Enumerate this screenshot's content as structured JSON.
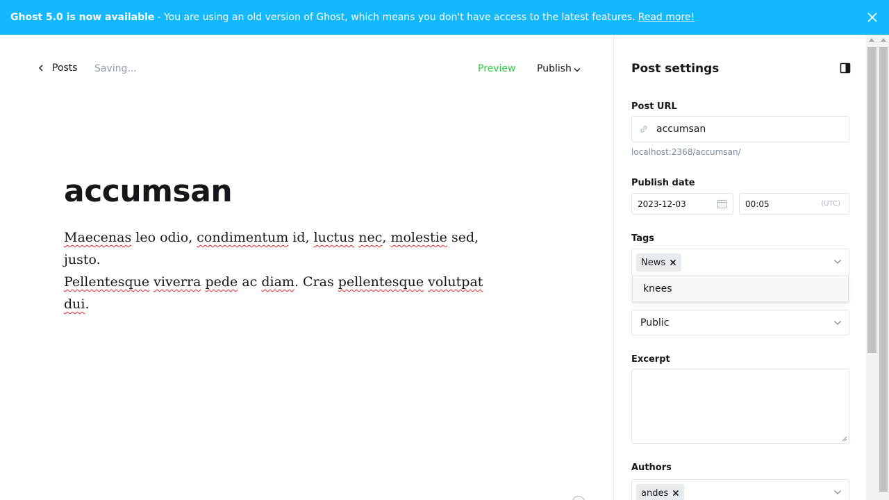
{
  "banner": {
    "strong": "Ghost 5.0 is now available",
    "message": "- You are using an old version of Ghost, which means you don't have access to the latest features.",
    "link": "Read more!",
    "bg_color": "#14b8ff"
  },
  "header": {
    "back_label": "Posts",
    "status": "Saving...",
    "preview_label": "Preview",
    "publish_label": "Publish"
  },
  "post": {
    "title": "accumsan",
    "body": [
      [
        {
          "t": "Maecenas",
          "s": true
        },
        {
          "t": " leo odio, ",
          "s": false
        },
        {
          "t": "condimentum",
          "s": true
        },
        {
          "t": " id, ",
          "s": false
        },
        {
          "t": "luctus",
          "s": true
        },
        {
          "t": " ",
          "s": false
        },
        {
          "t": "nec",
          "s": true
        },
        {
          "t": ", ",
          "s": false
        },
        {
          "t": "molestie",
          "s": true
        },
        {
          "t": " sed, justo.",
          "s": false
        }
      ],
      [
        {
          "t": "Pellentesque",
          "s": true
        },
        {
          "t": " ",
          "s": false
        },
        {
          "t": "viverra",
          "s": true
        },
        {
          "t": " ",
          "s": false
        },
        {
          "t": "pede",
          "s": true
        },
        {
          "t": " ac ",
          "s": false
        },
        {
          "t": "diam",
          "s": true
        },
        {
          "t": ". Cras ",
          "s": false
        },
        {
          "t": "pellentesque",
          "s": true
        },
        {
          "t": " ",
          "s": false
        },
        {
          "t": "volutpat",
          "s": true
        },
        {
          "t": " ",
          "s": false
        },
        {
          "t": "dui",
          "s": true
        },
        {
          "t": ".",
          "s": false
        }
      ]
    ]
  },
  "settings": {
    "title": "Post settings",
    "post_url_label": "Post URL",
    "post_url_value": "accumsan",
    "post_url_hint": "localhost:2368/accumsan/",
    "publish_date_label": "Publish date",
    "date_value": "2023-12-03",
    "time_value": "00:05",
    "timezone": "(UTC)",
    "tags_label": "Tags",
    "tags": [
      "News"
    ],
    "tag_suggestion": "knees",
    "access_value": "Public",
    "excerpt_label": "Excerpt",
    "authors_label": "Authors",
    "authors": [
      "andes"
    ]
  }
}
